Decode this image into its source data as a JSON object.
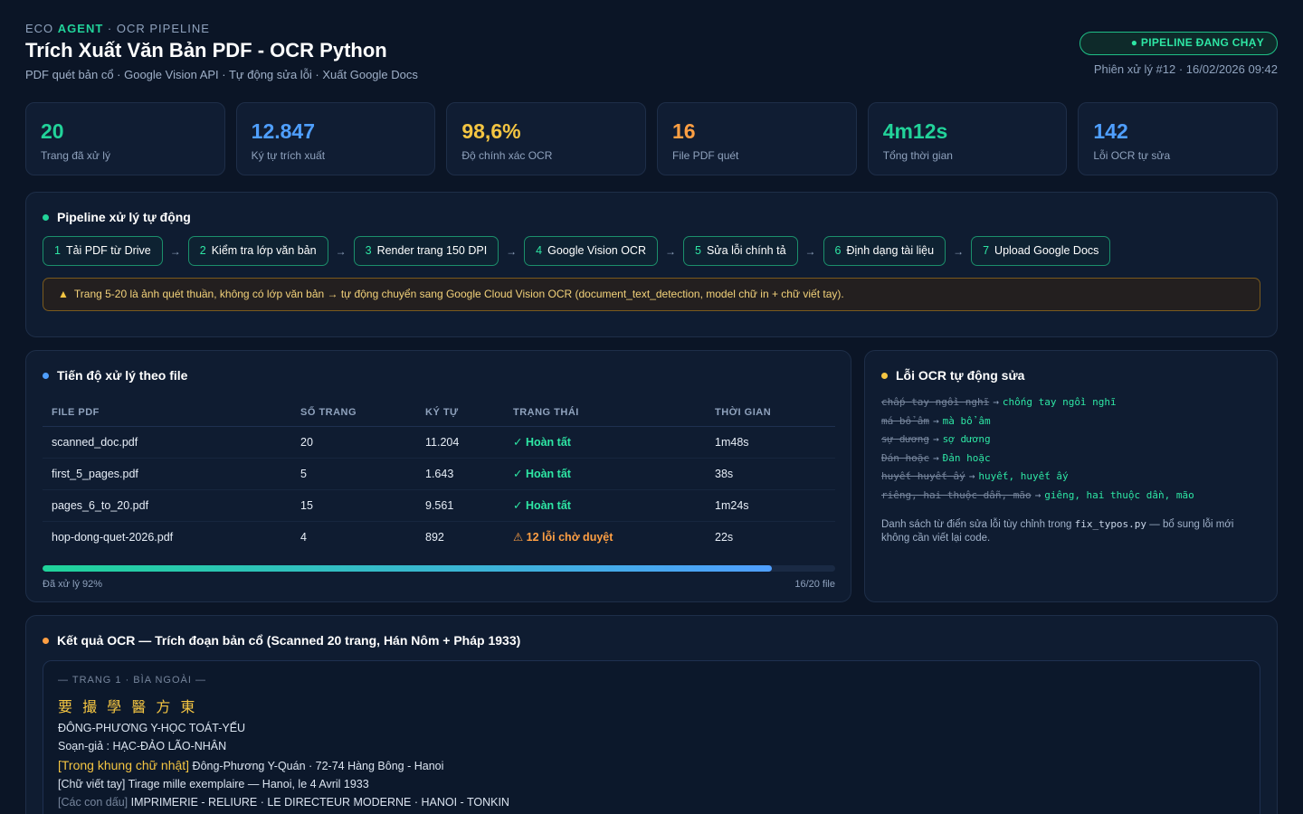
{
  "header": {
    "eyebrow_prefix": "ECO",
    "eyebrow_agent": "AGENT",
    "eyebrow_suffix": "· OCR PIPELINE",
    "title": "Trích Xuất Văn Bản PDF - OCR Python",
    "subtitle": "PDF quét bản cổ · Google Vision API · Tự động sửa lỗi · Xuất Google Docs",
    "status": "● PIPELINE ĐANG CHẠY",
    "session": "Phiên xử lý #12 · 16/02/2026 09:42"
  },
  "stats": [
    {
      "value": "20",
      "label": "Trang đã xử lý",
      "color": "#22d39a"
    },
    {
      "value": "12.847",
      "label": "Ký tự trích xuất",
      "color": "#4f9fff"
    },
    {
      "value": "98,6%",
      "label": "Độ chính xác OCR",
      "color": "#f4c542"
    },
    {
      "value": "16",
      "label": "File PDF quét",
      "color": "#ff9f43"
    },
    {
      "value": "4m12s",
      "label": "Tổng thời gian",
      "color": "#22d39a"
    },
    {
      "value": "142",
      "label": "Lỗi OCR tự sửa",
      "color": "#4f9fff"
    }
  ],
  "pipeline": {
    "title": "Pipeline xử lý tự động",
    "steps": [
      {
        "num": "1",
        "label": "Tải PDF từ Drive"
      },
      {
        "num": "2",
        "label": "Kiểm tra lớp văn bản"
      },
      {
        "num": "3",
        "label": "Render trang 150 DPI"
      },
      {
        "num": "4",
        "label": "Google Vision OCR"
      },
      {
        "num": "5",
        "label": "Sửa lỗi chính tả"
      },
      {
        "num": "6",
        "label": "Định dạng tài liệu"
      },
      {
        "num": "7",
        "label": "Upload Google Docs"
      }
    ],
    "arrow": "→",
    "warning": "Trang 5-20 là ảnh quét thuần, không có lớp văn bản → tự động chuyển sang Google Cloud Vision OCR (document_text_detection, model chữ in + chữ viết tay)."
  },
  "progress": {
    "title": "Tiến độ xử lý theo file",
    "columns": [
      "FILE PDF",
      "SỐ TRANG",
      "KÝ TỰ",
      "TRẠNG THÁI",
      "THỜI GIAN"
    ],
    "rows": [
      {
        "file": "scanned_doc.pdf",
        "pages": "20",
        "chars": "11.204",
        "status": "✓ Hoàn tất",
        "time": "1m48s",
        "state": "ok"
      },
      {
        "file": "first_5_pages.pdf",
        "pages": "5",
        "chars": "1.643",
        "status": "✓ Hoàn tất",
        "time": "38s",
        "state": "ok"
      },
      {
        "file": "pages_6_to_20.pdf",
        "pages": "15",
        "chars": "9.561",
        "status": "✓ Hoàn tất",
        "time": "1m24s",
        "state": "ok"
      },
      {
        "file": "hop-dong-quet-2026.pdf",
        "pages": "4",
        "chars": "892",
        "status": "⚠ 12 lỗi chờ duyệt",
        "time": "22s",
        "state": "pending"
      }
    ],
    "percent": 92,
    "left_label": "Đã xử lý 92%",
    "right_label": "16/20 file"
  },
  "fixes": {
    "title": "Lỗi OCR tự động sửa",
    "arrow": "→",
    "items": [
      {
        "old": "chấp tay ngồi nghĩ",
        "new": "chống tay ngồi nghĩ"
      },
      {
        "old": "má bổ âm",
        "new": "mà bổ âm"
      },
      {
        "old": "sự dương",
        "new": "sợ dương"
      },
      {
        "old": "Đán hoặc",
        "new": "Đản hoặc"
      },
      {
        "old": "huyết huyết ấy",
        "new": "huyết, huyết ấy"
      },
      {
        "old": "riêng, hai thuộc dẫn, mão",
        "new": "giêng, hai thuộc dần, mão"
      }
    ],
    "note_before": "Danh sách từ điển sửa lỗi tùy chỉnh trong",
    "note_code": "fix_typos.py",
    "note_after": "— bổ sung lỗi mới không cần viết lại code."
  },
  "results": {
    "title": "Kết quả OCR — Trích đoạn bản cổ (Scanned 20 trang, Hán Nôm + Pháp 1933)",
    "page_tag": "— TRANG 1 · BÌA NGOÀI —",
    "han_line": "要 撮 學 醫 方 東",
    "line1": "ĐÔNG-PHƯƠNG Y-HỌC TOÁT-YẾU",
    "line2": "Soạn-giả : HẠC-ĐẢO LÃO-NHÂN",
    "line3_tag": "[Trong khung chữ nhật]",
    "line3_text": "Đông-Phương Y-Quán · 72-74 Hàng Bông - Hanoi",
    "line4": "[Chữ viết tay] Tirage mille exemplaire — Hanoi, le 4 Avril 1933",
    "line5_tag": "[Các con dấu]",
    "line5_text": "IMPRIMERIE - RELIURE · LE DIRECTEUR MODERNE · HANOI - TONKIN"
  },
  "colors": {
    "green": "#22d39a",
    "blue": "#4f9fff",
    "yellow": "#f4c542",
    "orange": "#ff9f43"
  }
}
